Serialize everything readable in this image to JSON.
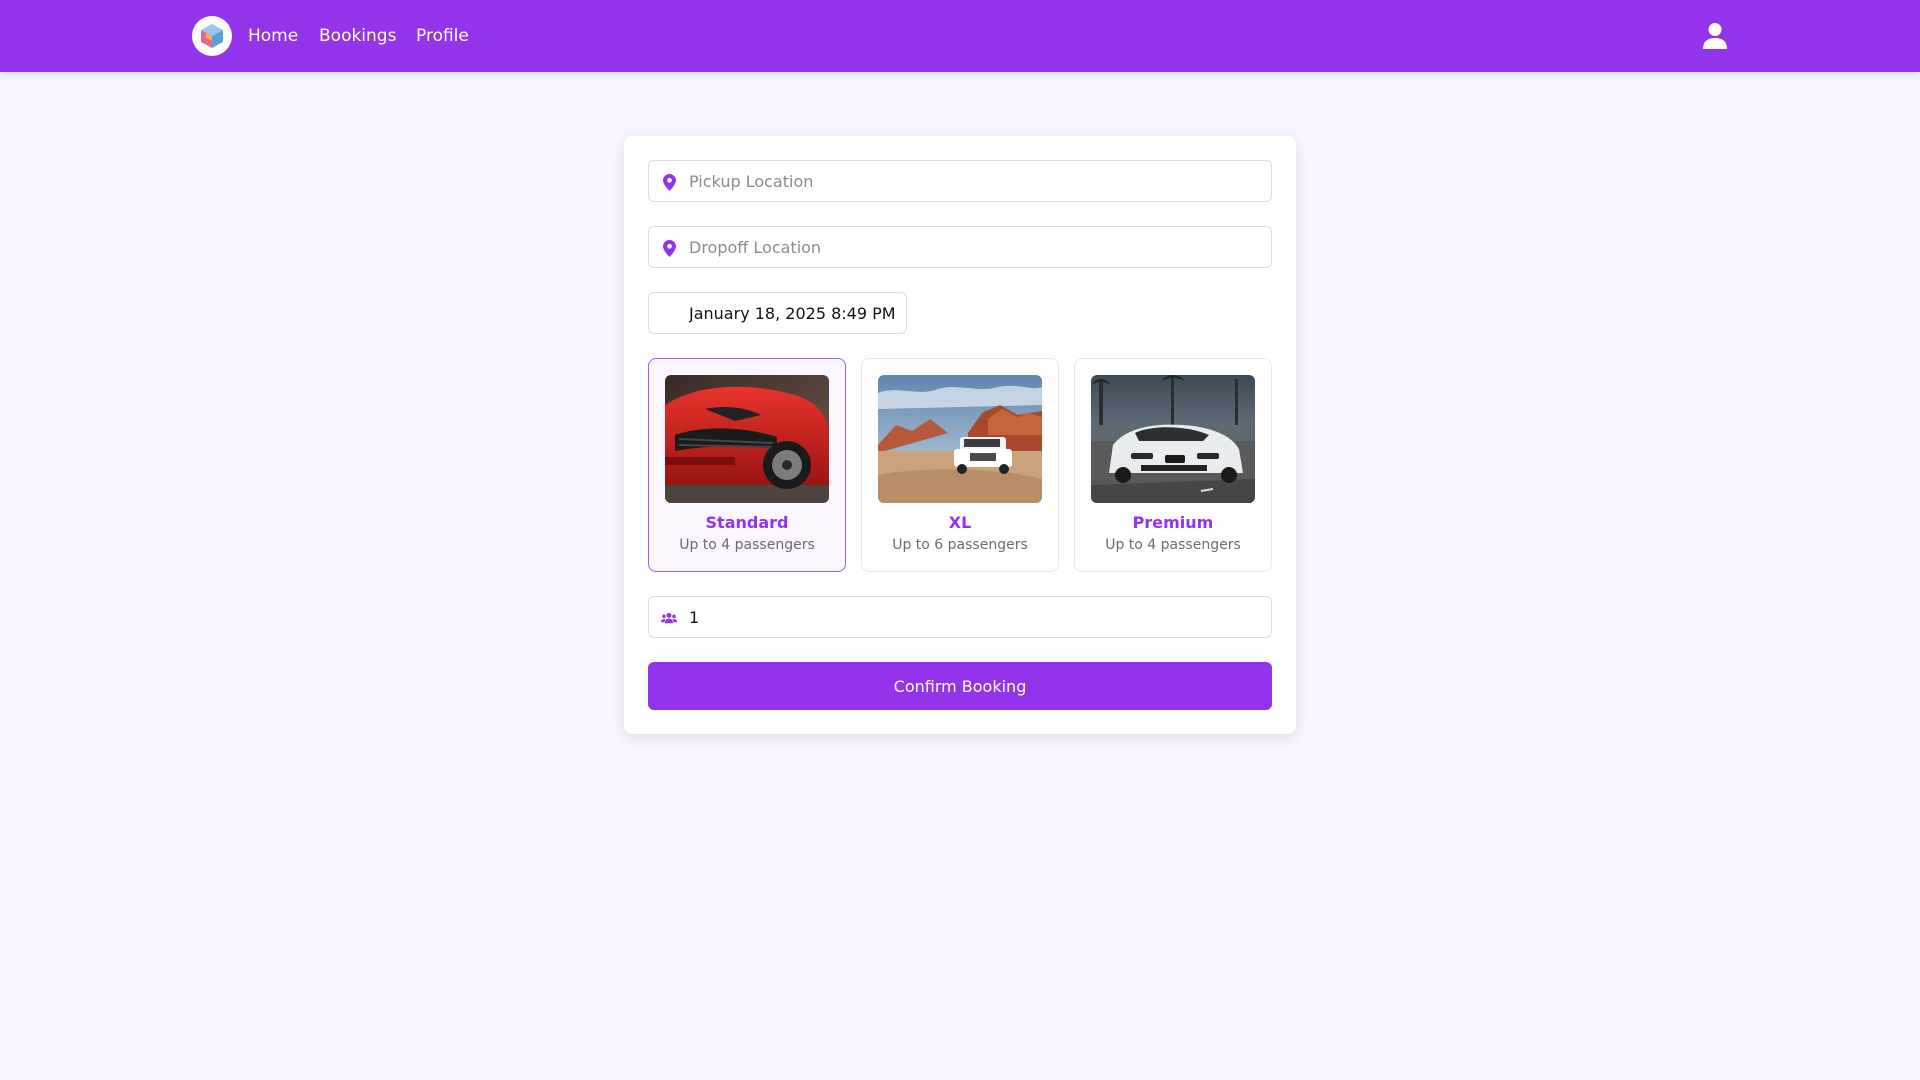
{
  "navbar": {
    "links": [
      {
        "label": "Home"
      },
      {
        "label": "Bookings"
      },
      {
        "label": "Profile"
      }
    ]
  },
  "booking": {
    "pickup_placeholder": "Pickup Location",
    "pickup_value": "",
    "dropoff_placeholder": "Dropoff Location",
    "dropoff_value": "",
    "datetime_value": "January 18, 2025 8:49 PM",
    "vehicles": [
      {
        "name": "Standard",
        "capacity": "Up to 4 passengers",
        "selected": true
      },
      {
        "name": "XL",
        "capacity": "Up to 6 passengers",
        "selected": false
      },
      {
        "name": "Premium",
        "capacity": "Up to 4 passengers",
        "selected": false
      }
    ],
    "passengers_value": "1",
    "confirm_label": "Confirm Booking"
  },
  "colors": {
    "brand": "#9333ea",
    "background": "#f9f4fe",
    "selected_border": "#a855f7"
  },
  "icons": {
    "logo": "cube-logo-icon",
    "user": "user-icon",
    "pickup": "map-pin-icon",
    "dropoff": "map-pin-icon",
    "passengers": "users-icon"
  }
}
